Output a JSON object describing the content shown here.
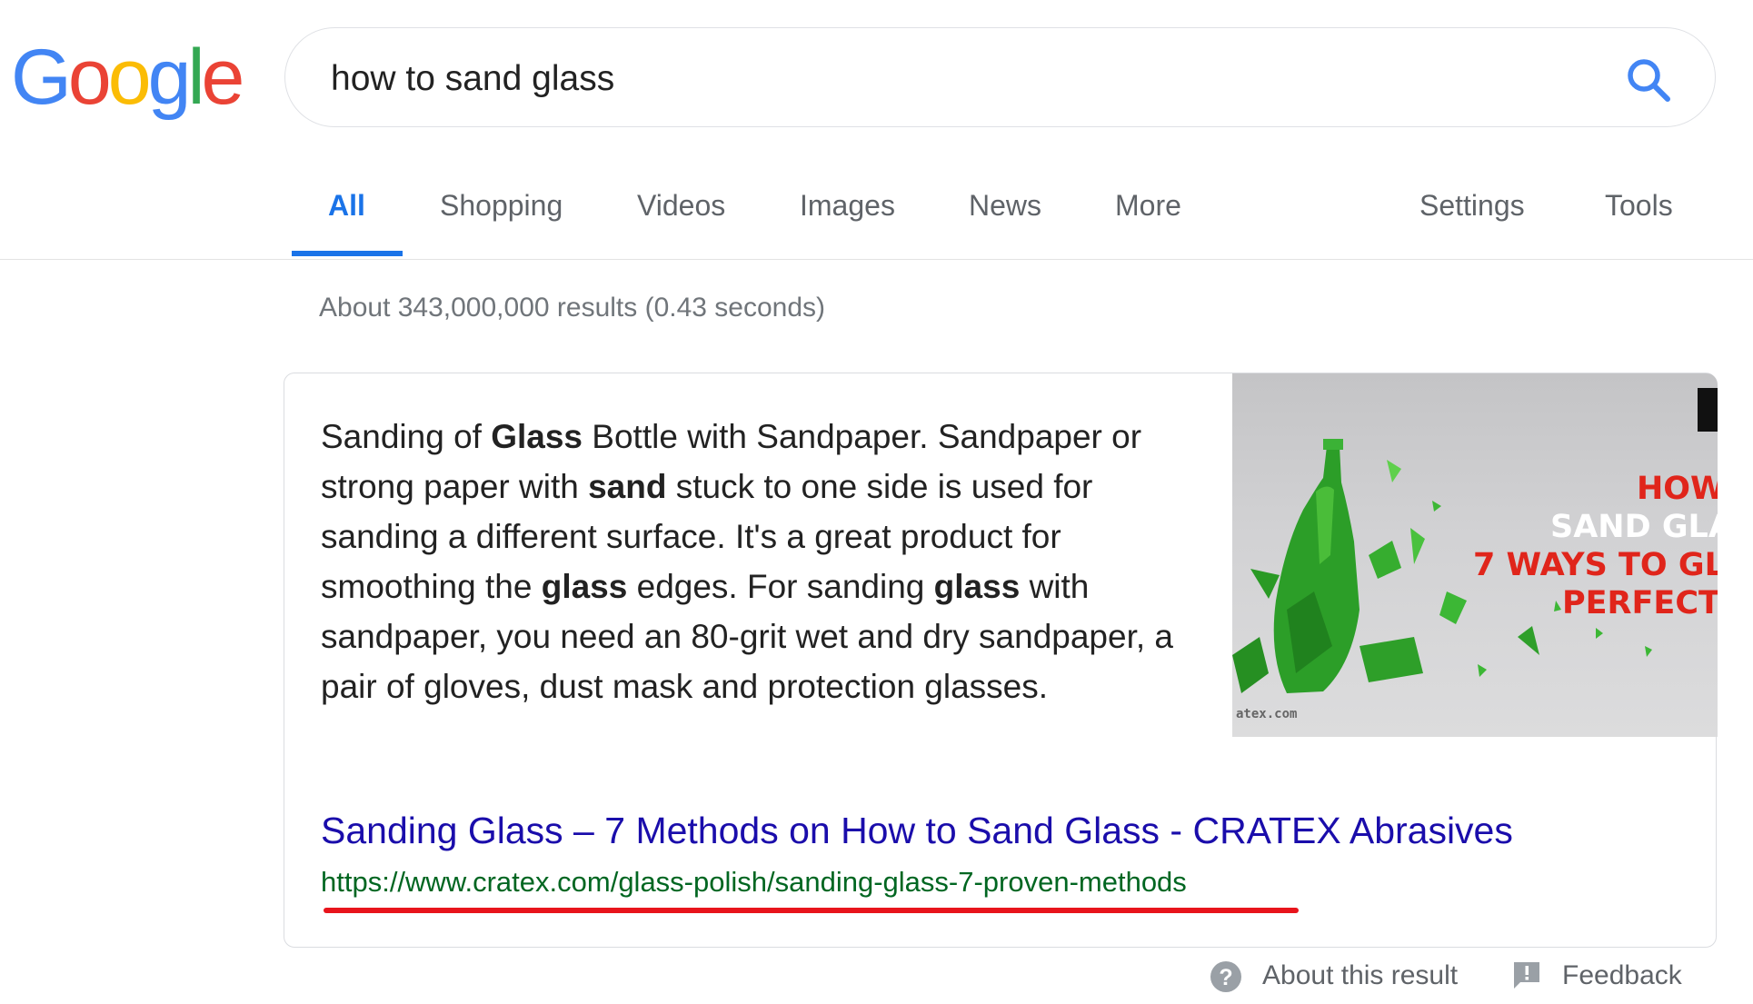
{
  "logo": {
    "letters": [
      {
        "char": "G",
        "color": "#4285F4"
      },
      {
        "char": "o",
        "color": "#EA4335"
      },
      {
        "char": "o",
        "color": "#FBBC05"
      },
      {
        "char": "g",
        "color": "#4285F4"
      },
      {
        "char": "l",
        "color": "#34A853"
      },
      {
        "char": "e",
        "color": "#EA4335"
      }
    ]
  },
  "search": {
    "query": "how to sand glass",
    "button_icon": "search-icon"
  },
  "tabs": [
    {
      "label": "All",
      "active": true
    },
    {
      "label": "Shopping"
    },
    {
      "label": "Videos"
    },
    {
      "label": "Images"
    },
    {
      "label": "News"
    },
    {
      "label": "More"
    },
    {
      "label": "Settings"
    },
    {
      "label": "Tools"
    }
  ],
  "results_stats": "About 343,000,000 results (0.43 seconds)",
  "snippet": {
    "text_segments": [
      {
        "t": "Sanding of "
      },
      {
        "t": "Glass",
        "b": true
      },
      {
        "t": " Bottle with Sandpaper. Sandpaper or strong paper with "
      },
      {
        "t": "sand",
        "b": true
      },
      {
        "t": " stuck to one side is used for sanding a different surface. It's a great product for smoothing the "
      },
      {
        "t": "glass",
        "b": true
      },
      {
        "t": " edges. For sanding "
      },
      {
        "t": "glass",
        "b": true
      },
      {
        "t": " with sandpaper, you need an 80-grit wet and dry sandpaper, a pair of gloves, dust mask and protection glasses."
      }
    ],
    "image": {
      "overlay_lines": [
        {
          "text": "HOW",
          "color": "#e0251b"
        },
        {
          "text": "SAND GLA",
          "color": "#ffffff"
        },
        {
          "text": "7 WAYS TO GL",
          "color": "#e0251b"
        },
        {
          "text": "PERFECT",
          "color": "#e0251b"
        }
      ],
      "watermark": "atex.com"
    },
    "title": "Sanding Glass – 7 Methods on How to Sand Glass - CRATEX Abrasives",
    "url": "https://www.cratex.com/glass-polish/sanding-glass-7-proven-methods",
    "colors": {
      "title": "#1a0dab",
      "url": "#006621",
      "highlight": "#e8141c"
    }
  },
  "footer": {
    "about": {
      "label": "About this result",
      "icon": "help-circle-icon"
    },
    "feedback": {
      "label": "Feedback",
      "icon": "feedback-icon"
    }
  },
  "colors": {
    "accent": "#1a73e8",
    "tab_text": "#5f6368"
  }
}
